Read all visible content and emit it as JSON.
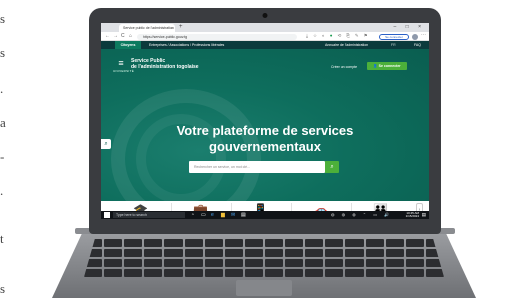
{
  "page_crop_letters": [
    "s",
    "s",
    ".",
    "a",
    "-",
    ".",
    "t",
    "s"
  ],
  "browser": {
    "tab_title": "Service public de l'administration",
    "tab_close": "×",
    "new_tab": "+",
    "window_controls": "–  □  ×",
    "url": "https://service-public.gouv.tg",
    "back": "←",
    "forward": "→",
    "reload": "C",
    "home": "⌂",
    "extensions": [
      "⤓",
      "☆",
      "◐",
      "●",
      "⟲",
      "⎘",
      "✎",
      "⚑"
    ],
    "sync_label": "Se connecter",
    "menu": "⋯"
  },
  "site": {
    "nav": {
      "active": "Citoyens",
      "items": [
        "Entreprises / Associations / Professions libérales"
      ],
      "directory": "Annuaire de l'administration",
      "language": "FR",
      "faq": "FAQ"
    },
    "logo_sub": "UNIVERSITÉ",
    "brand_line1": "Service Public",
    "brand_line2": "de l'administration togolaise",
    "create_account": "Créer un compte",
    "connect_button": "Se connecter",
    "headline_line1": "Votre plateforme de services",
    "headline_line2": "gouvernementaux",
    "search_placeholder": "Rechercher un service, un mot clé...",
    "cards": [
      {
        "icon": "🎓"
      },
      {
        "icon": "💼"
      },
      {
        "icon": "📱"
      },
      {
        "icon": "🚗"
      },
      {
        "icon": "👪"
      }
    ],
    "scroll_arrow": "›"
  },
  "taskbar": {
    "search_placeholder": "Type here to search",
    "apps": [
      "◔",
      "▭",
      "e",
      "▆",
      "✉",
      "▤"
    ],
    "tray": "◍ ◍ ◍ ⌃ ▭ 🔊",
    "time": "10:45 AM",
    "date": "1/15/2024",
    "notify": "▤"
  },
  "colors": {
    "nav_bg": "#0b3a3c",
    "hero_green": "#0e6e5d",
    "accent_green": "#4cb03a",
    "laptop_body": "#3a3c40"
  }
}
